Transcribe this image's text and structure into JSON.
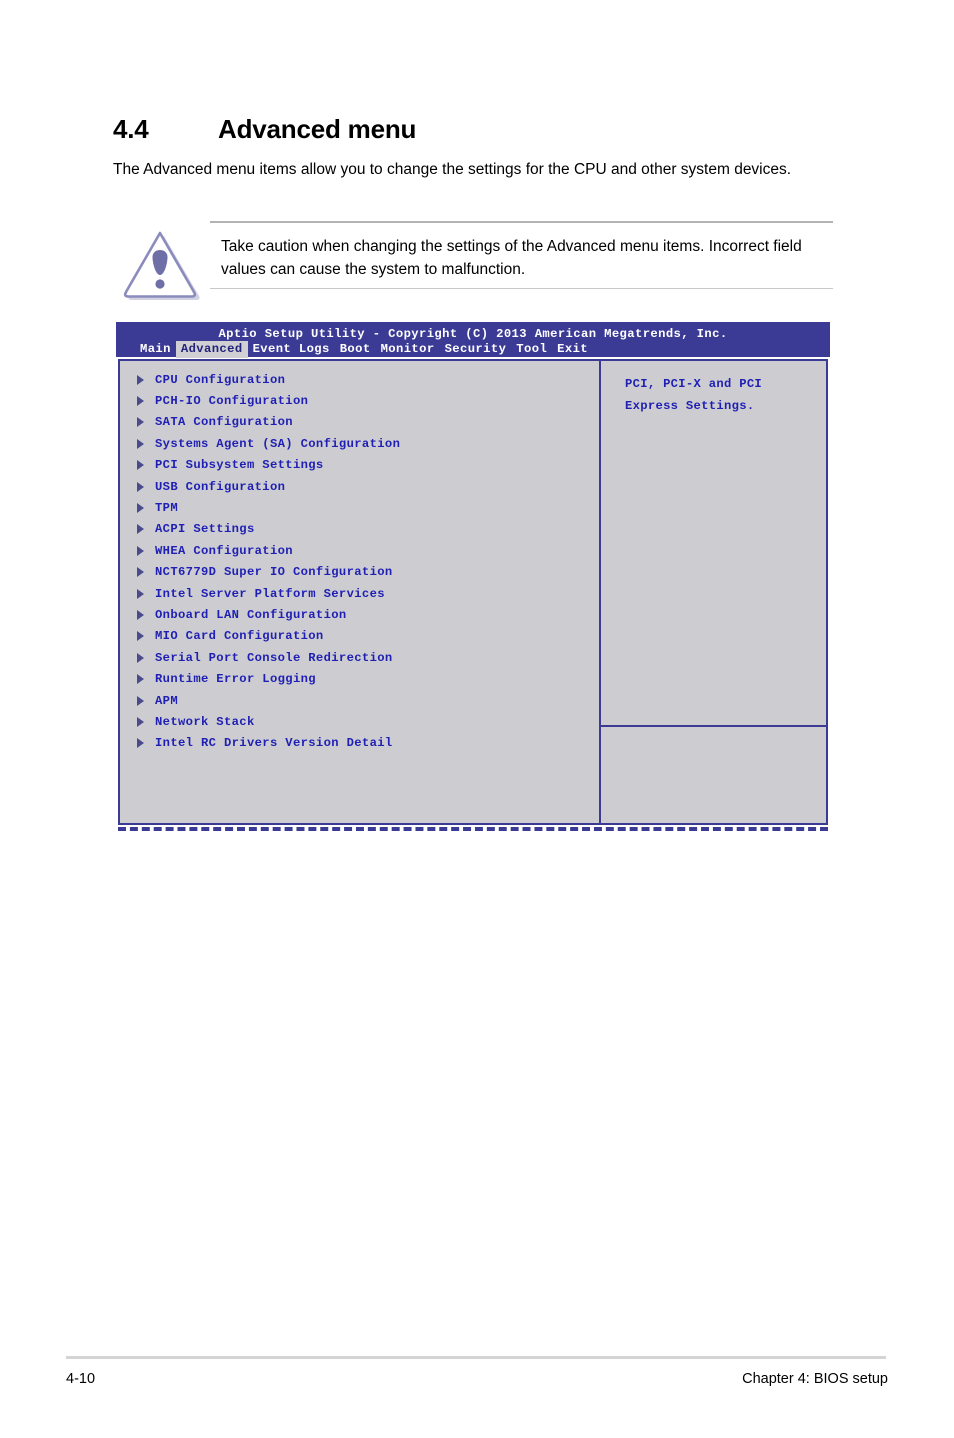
{
  "page": {
    "section_number": "4.4",
    "section_title": "Advanced menu",
    "intro": "The Advanced menu items allow you to change the settings for the CPU and other system devices."
  },
  "note": {
    "icon": "caution-triangle-icon",
    "text": "Take caution when changing the settings of the Advanced menu items. Incorrect field values can cause the system to malfunction."
  },
  "bios": {
    "title": "Aptio Setup Utility - Copyright (C) 2013 American Megatrends, Inc.",
    "tabs": [
      {
        "label": "Main",
        "active": false
      },
      {
        "label": "Advanced",
        "active": true
      },
      {
        "label": "Event Logs",
        "active": false
      },
      {
        "label": "Boot",
        "active": false
      },
      {
        "label": "Monitor",
        "active": false
      },
      {
        "label": "Security",
        "active": false
      },
      {
        "label": "Tool",
        "active": false
      },
      {
        "label": "Exit",
        "active": false
      }
    ],
    "menu_items": [
      "CPU Configuration",
      "PCH-IO Configuration",
      "SATA Configuration",
      "Systems Agent (SA) Configuration",
      "PCI Subsystem Settings",
      "USB Configuration",
      "TPM",
      "ACPI Settings",
      "WHEA Configuration",
      "NCT6779D Super IO Configuration",
      "Intel Server Platform Services",
      "Onboard LAN Configuration",
      "MIO Card Configuration",
      "Serial Port Console Redirection",
      "Runtime Error Logging",
      "APM",
      "Network Stack",
      "Intel RC Drivers Version Detail"
    ],
    "help_text": "PCI, PCI-X and PCI Express Settings.",
    "colors": {
      "header_bar": "#3b3b96",
      "panel_background": "#cdcdd1",
      "panel_border": "#3b3b96",
      "menu_text": "#1f1fb4",
      "active_tab_background": "#cfcfd4",
      "active_tab_text": "#23237a",
      "header_text": "#ffffff"
    }
  },
  "footer": {
    "page_number": "4-10",
    "chapter": "Chapter 4: BIOS setup"
  }
}
